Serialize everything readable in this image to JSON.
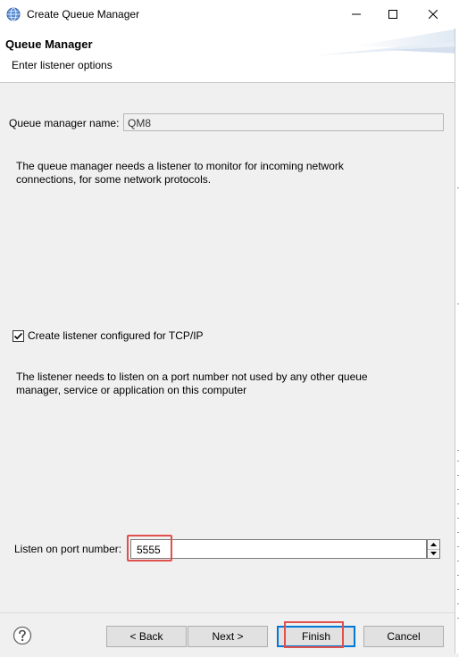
{
  "window": {
    "title": "Create Queue Manager"
  },
  "header": {
    "title": "Queue Manager",
    "subtitle": "Enter listener options"
  },
  "form": {
    "qm_name_label": "Queue manager name:",
    "qm_name_value": "QM8",
    "info_text": "The queue manager needs a listener to monitor for incoming network connections, for some network protocols.",
    "create_listener_label": "Create listener configured for TCP/IP",
    "create_listener_checked": true,
    "port_info_text": "The listener needs to listen on a port number not used by any other queue manager, service or application on this computer",
    "port_label": "Listen on port number:",
    "port_value": "5555"
  },
  "buttons": {
    "back": "< Back",
    "next": "Next >",
    "finish": "Finish",
    "cancel": "Cancel"
  },
  "icons": {
    "app": "globe-icon",
    "help": "help-icon",
    "minimize": "minimize-icon",
    "maximize": "maximize-icon",
    "close": "close-icon",
    "checkbox": "checkmark-icon",
    "spin_up": "spin-up-icon",
    "spin_down": "spin-down-icon"
  },
  "colors": {
    "highlight": "#e0504c",
    "focus_border": "#0078d7"
  }
}
